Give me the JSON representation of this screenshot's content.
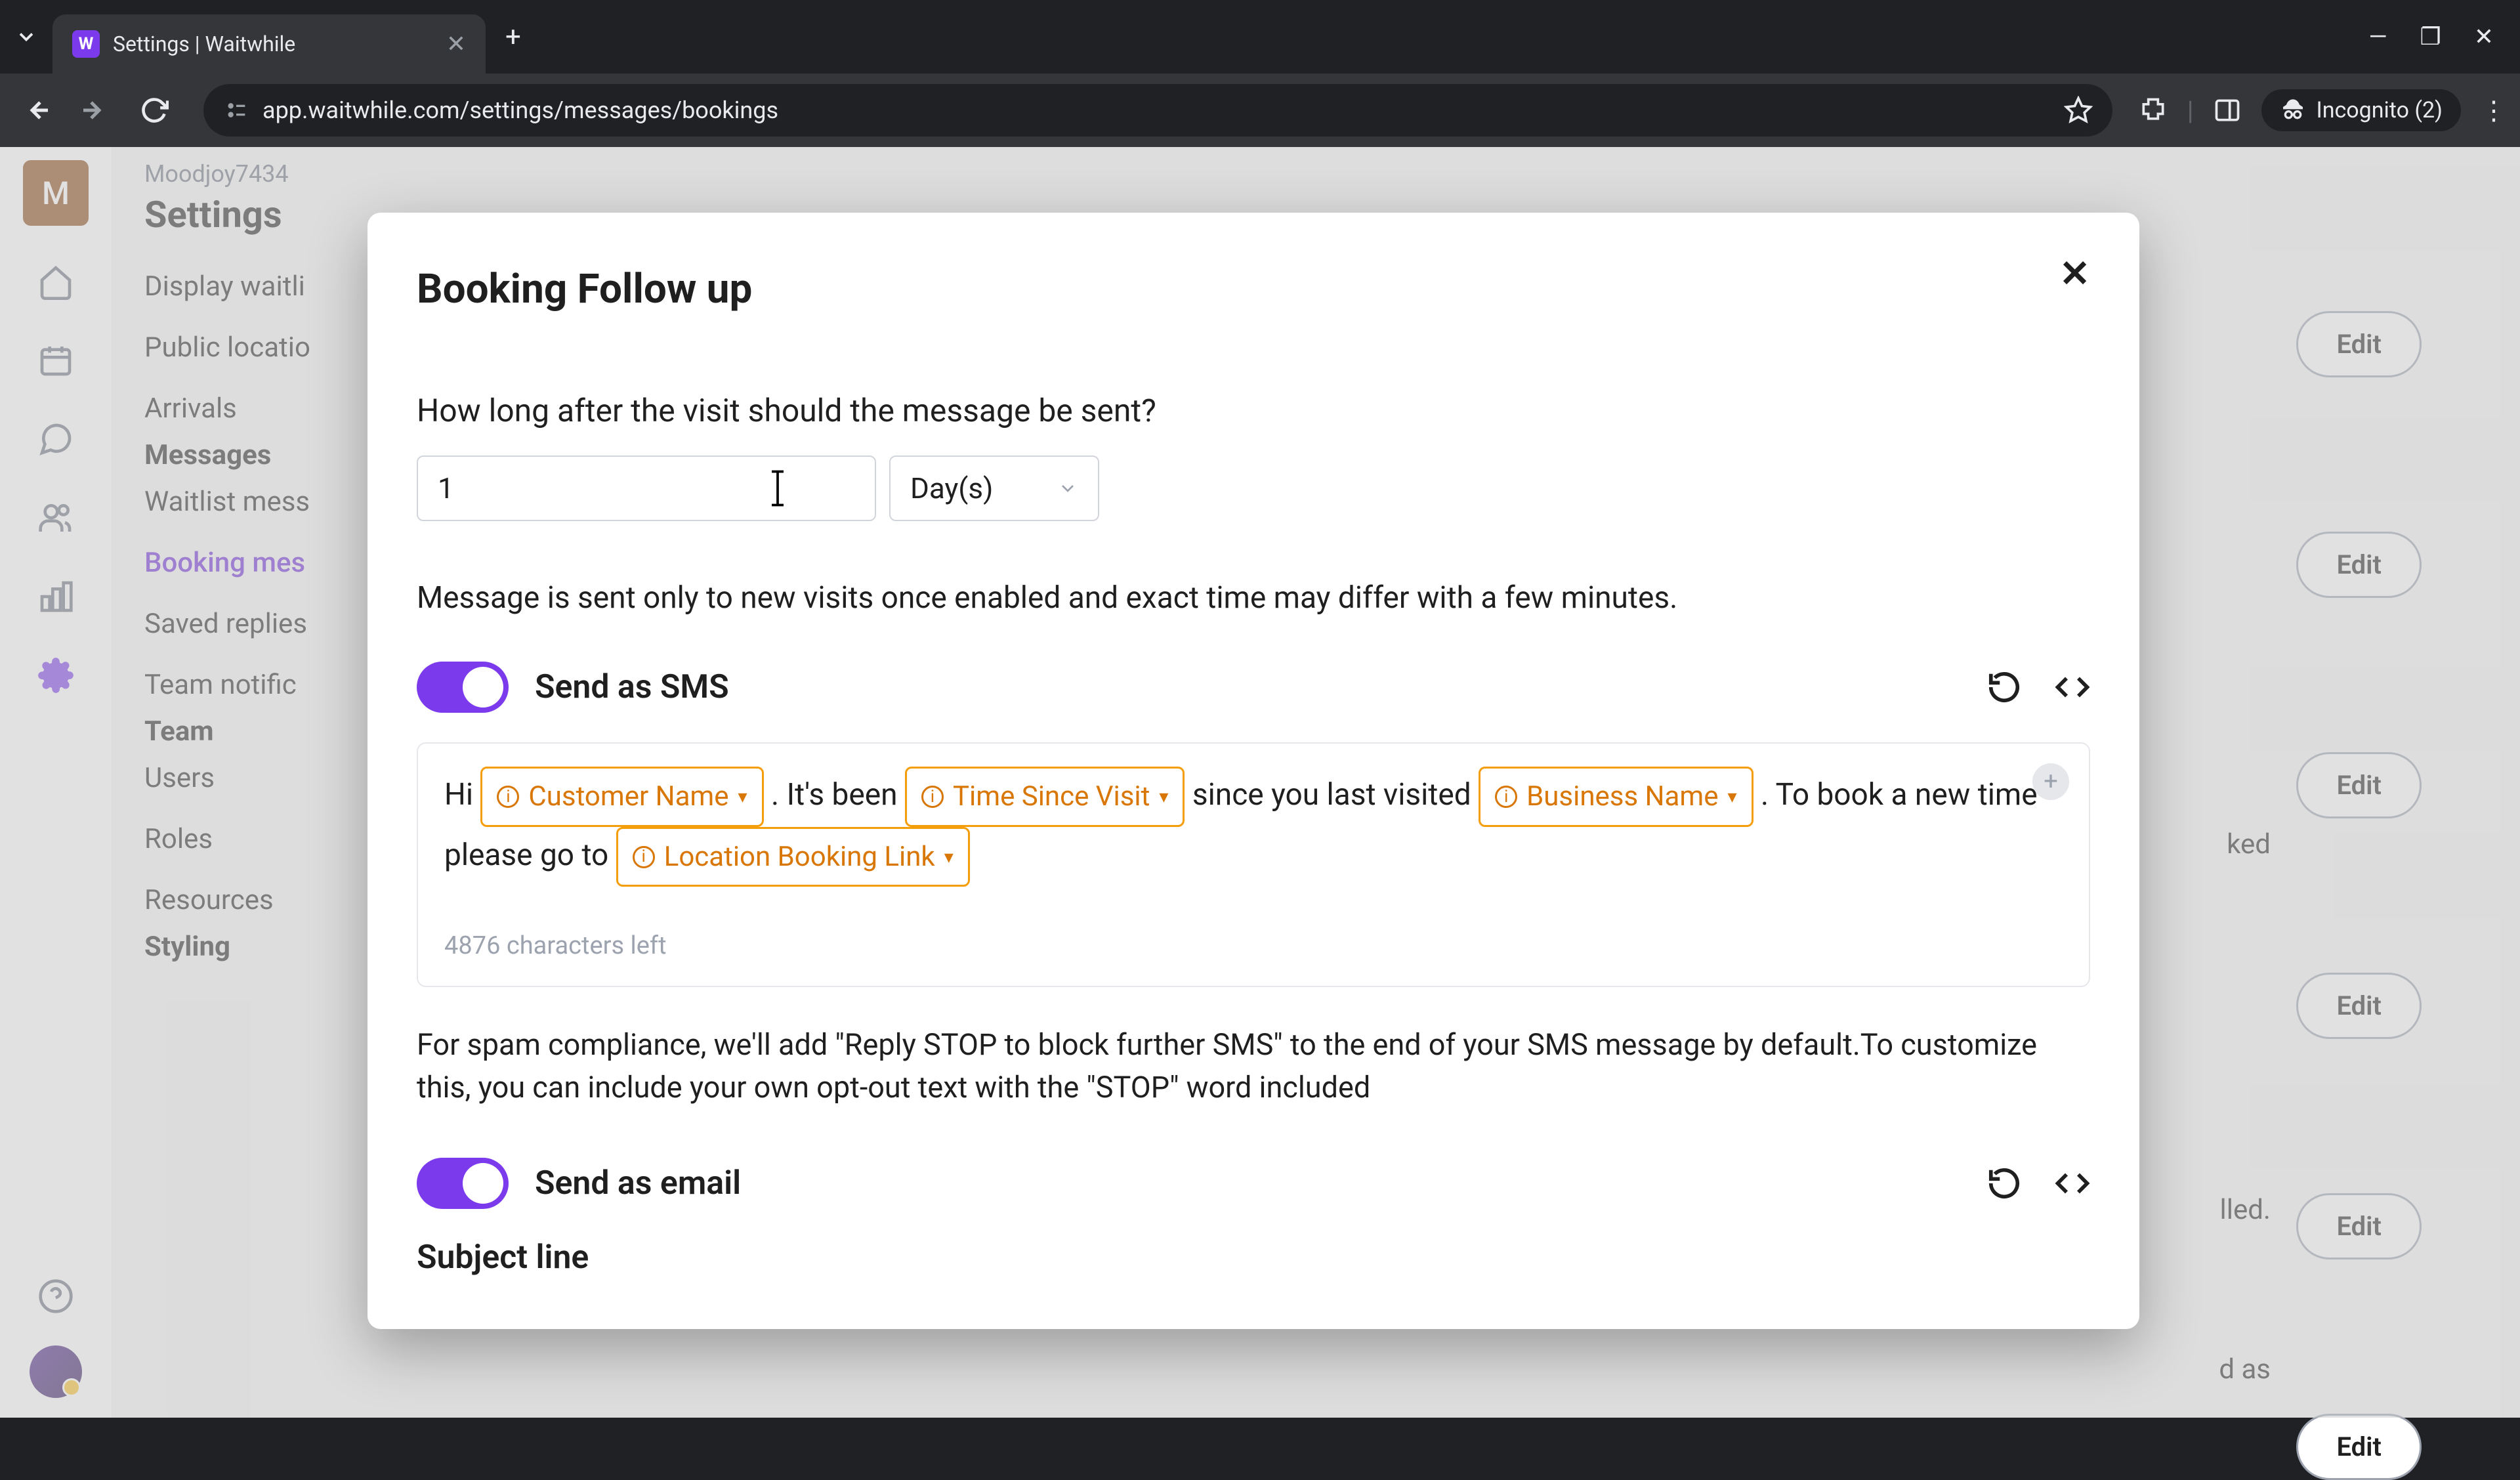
{
  "browser": {
    "tab_title": "Settings | Waitwhile",
    "url": "app.waitwhile.com/settings/messages/bookings",
    "incognito_label": "Incognito (2)",
    "favicon_letter": "W"
  },
  "app": {
    "avatar_letter": "M",
    "workspace": "Moodjoy7434",
    "page_title": "Settings",
    "nav": {
      "display_waitlist": "Display waitli",
      "public_location": "Public locatio",
      "arrivals": "Arrivals",
      "messages_header": "Messages",
      "waitlist_messages": "Waitlist mess",
      "booking_messages": "Booking mes",
      "saved_replies": "Saved replies",
      "team_notifications": "Team notific",
      "team_header": "Team",
      "users": "Users",
      "roles": "Roles",
      "resources": "Resources",
      "styling_header": "Styling"
    },
    "edit_label": "Edit",
    "bg_snippets": {
      "ked": "ked",
      "lled": "lled.",
      "das": "d as"
    }
  },
  "modal": {
    "title": "Booking Follow up",
    "question": "How long after the visit should the message be sent?",
    "delay_value": "1",
    "delay_unit": "Day(s)",
    "note": "Message is sent only to new visits once enabled and exact time may differ with a few minutes.",
    "sms_label": "Send as SMS",
    "email_label": "Send as email",
    "subject_label": "Subject line",
    "msg": {
      "hi": "Hi ",
      "customer_name": "Customer Name",
      "its_been": ". It's been ",
      "time_since": "Time Since Visit",
      "since_visited": " since you last visited ",
      "business_name": "Business Name",
      "to_book": ". To book a new time please go to ",
      "booking_link": "Location Booking Link"
    },
    "char_count": "4876 characters left",
    "compliance": "For spam compliance, we'll add \"Reply STOP to block further SMS\" to the end of your SMS message by default.To customize this, you can include your own opt-out text with the \"STOP\" word included"
  }
}
